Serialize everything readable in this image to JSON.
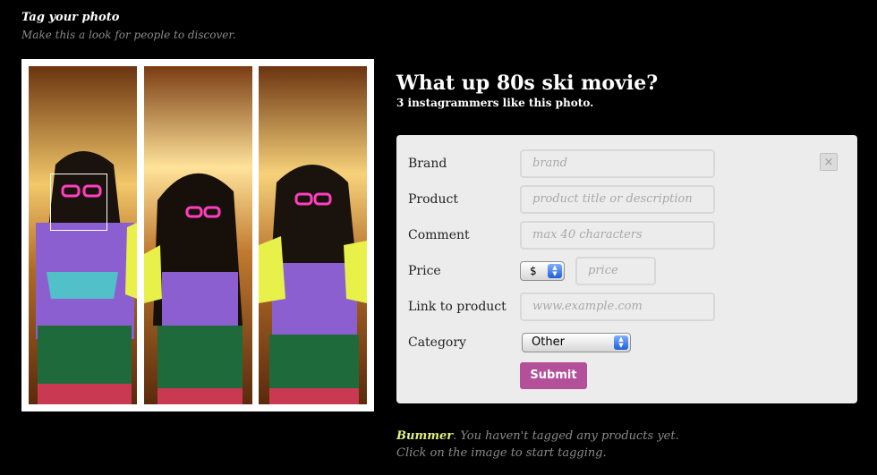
{
  "header": {
    "title": "Tag your photo",
    "subtitle": "Make this a look for people to discover."
  },
  "photo": {
    "title": "What up 80s ski movie?",
    "likes": "3 instagrammers like this photo."
  },
  "form": {
    "close_label": "×",
    "fields": {
      "brand": {
        "label": "Brand",
        "placeholder": "brand"
      },
      "product": {
        "label": "Product",
        "placeholder": "product title or description"
      },
      "comment": {
        "label": "Comment",
        "placeholder": "max 40 characters"
      },
      "price": {
        "label": "Price",
        "currency": "$",
        "placeholder": "price"
      },
      "link": {
        "label": "Link to product",
        "placeholder": "www.example.com"
      },
      "category": {
        "label": "Category",
        "value": "Other"
      }
    },
    "submit_label": "Submit"
  },
  "footer": {
    "bummer": "Bummer",
    "line1_rest": ". You haven't tagged any products yet.",
    "line2": "Click on the image to start tagging."
  },
  "colors": {
    "accent": "#b44f9a",
    "highlight": "#e3f07a"
  }
}
